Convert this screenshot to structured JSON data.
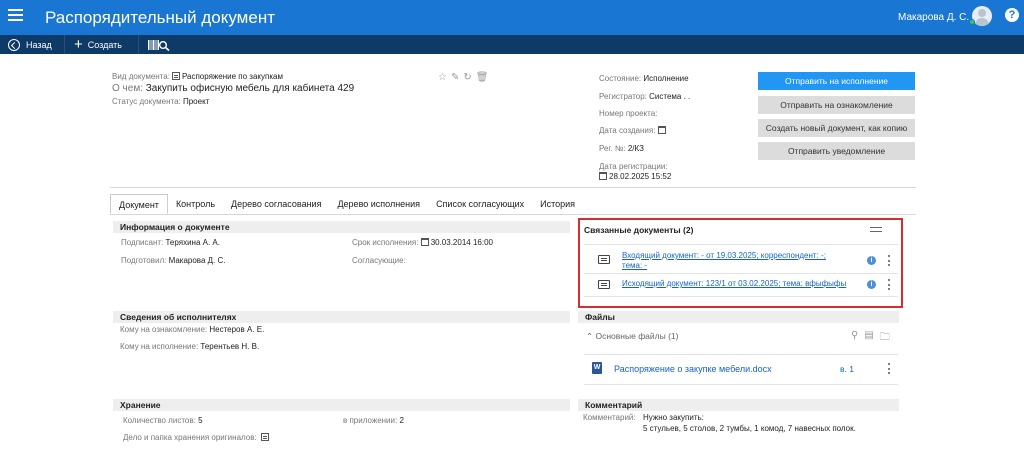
{
  "header": {
    "title": "Распорядительный документ",
    "user_name": "Макарова Д. С.",
    "help_label": "?"
  },
  "toolbar": {
    "back_label": "Назад",
    "create_label": "Создать"
  },
  "document": {
    "type_label": "Вид документа:",
    "type_value": "Распоряжение по закупкам",
    "subject_label": "О чем:",
    "subject_value": "Закупить офисную мебель для кабинета 429",
    "status_label": "Статус документа:",
    "status_value": "Проект"
  },
  "details": {
    "state_label": "Состояние:",
    "state_value": "Исполнение",
    "registrar_label": "Регистратор:",
    "registrar_value": "Система . .",
    "project_number_label": "Номер проекта:",
    "created_label": "Дата создания:",
    "reg_number_label": "Рег. №:",
    "reg_number_value": "2/КЗ",
    "reg_date_label": "Дата регистрации:",
    "reg_date_value": "28.02.2025 15:52"
  },
  "actions": {
    "send_execution": "Отправить на исполнение",
    "send_review": "Отправить на ознакомление",
    "create_copy": "Создать новый документ, как копию",
    "send_notification": "Отправить уведомление"
  },
  "tabs": [
    {
      "label": "Документ"
    },
    {
      "label": "Контроль"
    },
    {
      "label": "Дерево согласования"
    },
    {
      "label": "Дерево исполнения"
    },
    {
      "label": "Список согласующих"
    },
    {
      "label": "История"
    }
  ],
  "info_section": {
    "title": "Информация о документе",
    "signer_label": "Подписант:",
    "signer_value": "Теряхина А. А.",
    "prepared_label": "Подготовил:",
    "prepared_value": "Макарова Д. С.",
    "deadline_label": "Срок исполнения:",
    "deadline_value": "30.03.2014 16:00",
    "approvers_label": "Согласующие:"
  },
  "related": {
    "title": "Связанные документы (2)",
    "items": [
      {
        "line1": "Входящий документ: - от 19.03.2025; корреспондент: -;",
        "line2": "тема: -"
      },
      {
        "line1": "Исходящий документ: 123/1 от 03.02.2025; тема: вфыфыфы",
        "line2": ""
      }
    ]
  },
  "executors_section": {
    "title": "Сведения об исполнителях",
    "review_label": "Кому на ознакомление:",
    "review_value": "Нестеров А. Е.",
    "execution_label": "Кому на исполнение:",
    "execution_value": "Терентьев Н. В."
  },
  "files": {
    "title": "Файлы",
    "group_label": "Основные файлы (1)",
    "file_name": "Распоряжение о закупке мебели.docx",
    "file_version": "в. 1",
    "word_letter": "W"
  },
  "storage": {
    "title": "Хранение",
    "sheets_label": "Количество листов:",
    "sheets_value": "5",
    "appendix_label": "в приложении:",
    "appendix_value": "2",
    "folder_label": "Дело и папка хранения оригиналов:"
  },
  "comment": {
    "title": "Комментарий",
    "label": "Комментарий:",
    "line1": "Нужно закупить:",
    "line2": "5 стульев, 5 столов, 2 тумбы, 1 комод, 7 навесных полок."
  }
}
